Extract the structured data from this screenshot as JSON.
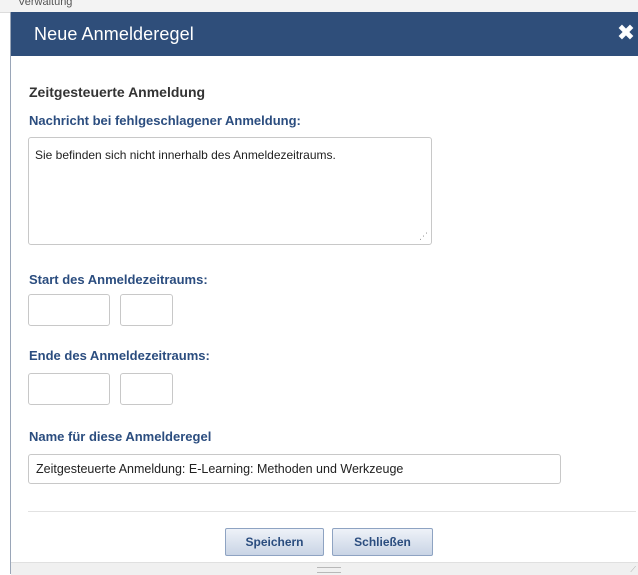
{
  "background": {
    "partial_text": "Verwaltung"
  },
  "dialog": {
    "title": "Neue Anmelderegel",
    "close_symbol": "✖",
    "section_heading": "Zeitgesteuerte Anmeldung",
    "message_label": "Nachricht bei fehlgeschlagener Anmeldung:",
    "message_value": "Sie befinden sich nicht innerhalb des Anmeldezeitraums.",
    "start_label": "Start des Anmeldezeitraums:",
    "start_date_value": "",
    "start_time_value": "",
    "end_label": "Ende des Anmeldezeitraums:",
    "end_date_value": "",
    "end_time_value": "",
    "name_label": "Name für diese Anmelderegel",
    "name_value": "Zeitgesteuerte Anmeldung: E-Learning: Methoden und Werkzeuge",
    "save_label": "Speichern",
    "close_label": "Schließen"
  },
  "icons": {
    "close": "close-icon",
    "resize": "resize-grip-icon"
  },
  "colors": {
    "titlebar": "#2f4e7a",
    "label_blue": "#2b4d7f",
    "button_border": "#8ea3c2"
  }
}
